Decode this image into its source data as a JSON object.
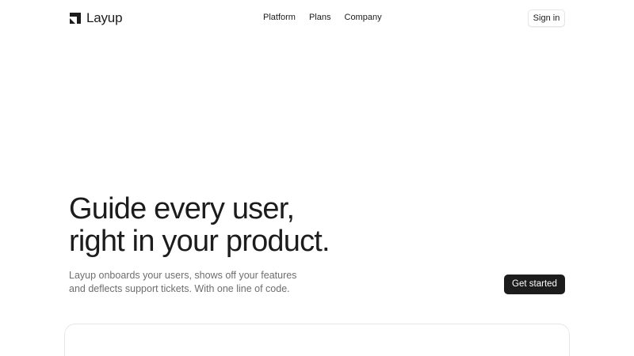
{
  "brand": {
    "name": "Layup",
    "logo_icon": "layup-logo-icon"
  },
  "nav": {
    "items": [
      {
        "label": "Platform"
      },
      {
        "label": "Plans"
      },
      {
        "label": "Company"
      }
    ]
  },
  "header": {
    "signin_label": "Sign in"
  },
  "hero": {
    "headline_line1": "Guide every user,",
    "headline_line2": "right in your product.",
    "subtext_line1": "Layup onboards your users, shows off your features",
    "subtext_line2": "and deflects support tickets. With one line of code.",
    "cta_label": "Get started"
  },
  "colors": {
    "text": "#1c1c1c",
    "muted_text": "#6e6e6e",
    "cta_background": "#1c1c1c",
    "cta_text": "#ffffff",
    "border": "#e5e5e5",
    "background": "#ffffff"
  }
}
